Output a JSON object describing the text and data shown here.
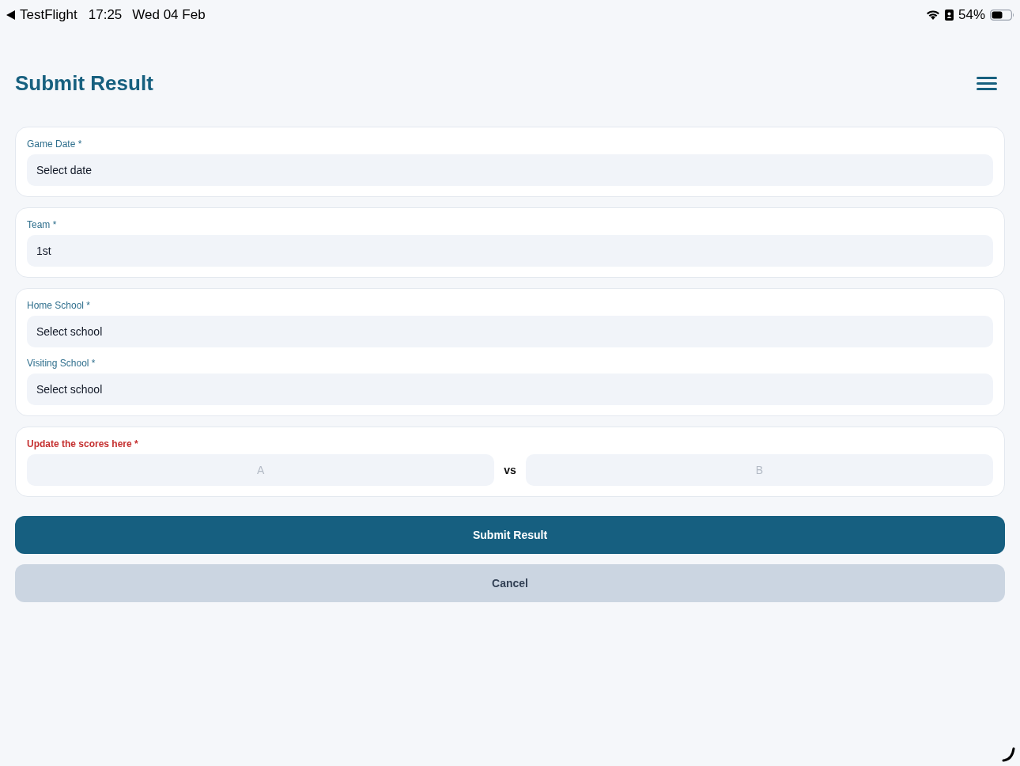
{
  "status_bar": {
    "back_app": "TestFlight",
    "time": "17:25",
    "date": "Wed 04 Feb",
    "battery_percent": "54%"
  },
  "header": {
    "title": "Submit Result"
  },
  "cards": [
    {
      "kind": "fields",
      "fields": [
        {
          "label": "Game Date *",
          "value": "Select date"
        }
      ]
    },
    {
      "kind": "fields",
      "fields": [
        {
          "label": "Team *",
          "value": "1st"
        }
      ]
    },
    {
      "kind": "fields",
      "fields": [
        {
          "label": "Home School *",
          "value": "Select school"
        },
        {
          "label": "Visiting School *",
          "value": "Select school"
        }
      ]
    },
    {
      "kind": "scores",
      "label": "Update the scores here *",
      "home_score": {
        "placeholder": "A"
      },
      "separator": "vs",
      "away_score": {
        "placeholder": "B"
      }
    }
  ],
  "buttons": [
    {
      "kind": "primary",
      "label": "Submit Result"
    },
    {
      "kind": "secondary",
      "label": "Cancel"
    }
  ]
}
